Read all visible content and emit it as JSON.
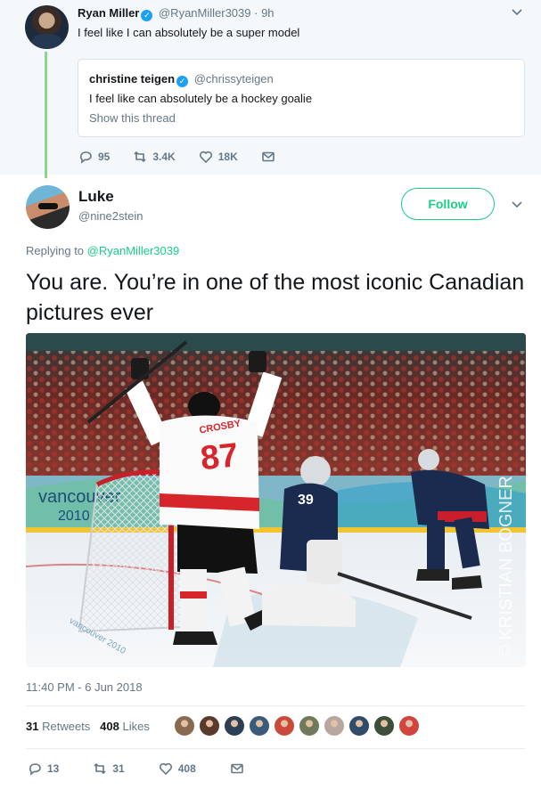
{
  "parent_tweet": {
    "name": "Ryan Miller",
    "handle": "@RyanMiller3039",
    "time": "· 9h",
    "text": "I feel like I can absolutely be a super model",
    "quote": {
      "name": "christine teigen",
      "handle": "@chrissyteigen",
      "text": "I feel like can absolutely be a hockey goalie",
      "show_thread": "Show this thread"
    },
    "actions": {
      "replies": "95",
      "retweets": "3.4K",
      "likes": "18K"
    }
  },
  "main_tweet": {
    "name": "Luke",
    "handle": "@nine2stein",
    "follow_label": "Follow",
    "reply_prefix": "Replying to",
    "reply_handle": "@RyanMiller3039",
    "text": "You are. You’re in one of the most iconic Canadian pictures ever",
    "photo": {
      "jersey_number": "87",
      "jersey_name": "CROSBY",
      "goalie_number": "39",
      "dasher_text_1": "vancouver",
      "dasher_text_2": "2010",
      "watermark": "© KRISTIAN BOGNER",
      "net_logo": "vancouver 2010"
    },
    "timestamp": "11:40 PM - 6 Jun 2018",
    "stats": {
      "retweets_count": "31",
      "retweets_label": "Retweets",
      "likes_count": "408",
      "likes_label": "Likes"
    },
    "likers": [
      "#8a6a4f",
      "#5b3a2e",
      "#2d3f55",
      "#3b5b7a",
      "#c94a3a",
      "#6f7a5a",
      "#b8a6a0",
      "#2f4c6b",
      "#3d4f3a",
      "#d2443f"
    ],
    "actions": {
      "replies": "13",
      "retweets": "31",
      "likes": "408"
    }
  },
  "colors": {
    "accent": "#19cf86",
    "verified": "#1da1f2",
    "muted": "#657786",
    "thread_line": "#8ed38e"
  },
  "icons": [
    "chevron-down-icon",
    "reply-icon",
    "retweet-icon",
    "heart-icon",
    "envelope-icon",
    "verified-badge-icon"
  ]
}
